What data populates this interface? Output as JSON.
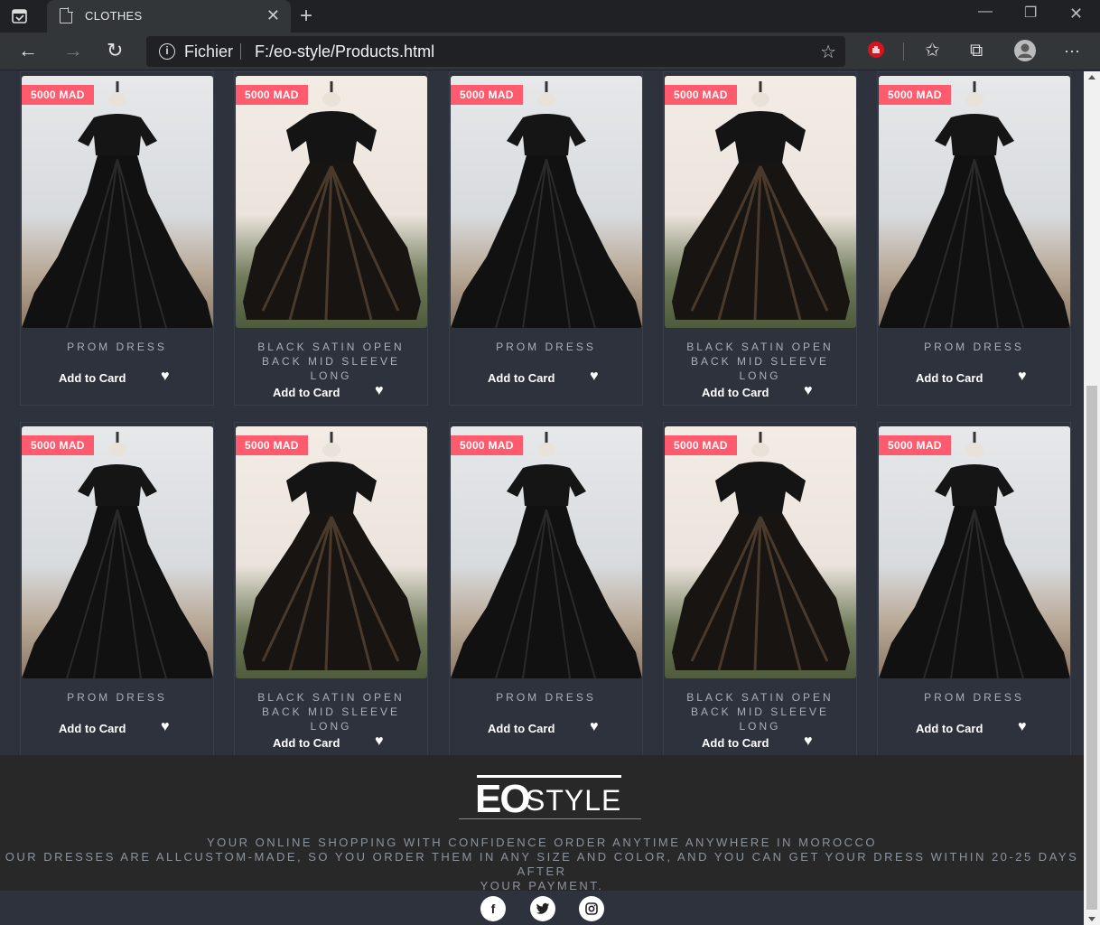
{
  "browser": {
    "tab_title": "CLOTHES",
    "address_protocol": "Fichier",
    "address_url": "F:/eo-style/Products.html"
  },
  "products": {
    "row1": [
      {
        "price": "5000 MAD",
        "name": "PROM DRESS",
        "add": "Add to Card",
        "style": "a"
      },
      {
        "price": "5000 MAD",
        "name": "BLACK SATIN OPEN BACK MID SLEEVE LONG",
        "add": "Add to Card",
        "style": "b"
      },
      {
        "price": "5000 MAD",
        "name": "PROM DRESS",
        "add": "Add to Card",
        "style": "a"
      },
      {
        "price": "5000 MAD",
        "name": "BLACK SATIN OPEN BACK MID SLEEVE LONG",
        "add": "Add to Card",
        "style": "b"
      },
      {
        "price": "5000 MAD",
        "name": "PROM DRESS",
        "add": "Add to Card",
        "style": "a"
      }
    ],
    "row2": [
      {
        "price": "5000 MAD",
        "name": "PROM DRESS",
        "add": "Add to Card",
        "style": "a"
      },
      {
        "price": "5000 MAD",
        "name": "BLACK SATIN OPEN BACK MID SLEEVE LONG",
        "add": "Add to Card",
        "style": "b"
      },
      {
        "price": "5000 MAD",
        "name": "PROM DRESS",
        "add": "Add to Card",
        "style": "a"
      },
      {
        "price": "5000 MAD",
        "name": "BLACK SATIN OPEN BACK MID SLEEVE LONG",
        "add": "Add to Card",
        "style": "b"
      },
      {
        "price": "5000 MAD",
        "name": "PROM DRESS",
        "add": "Add to Card",
        "style": "a"
      }
    ]
  },
  "footer": {
    "logo_eo": "EO",
    "logo_style": "STYLE",
    "tagline_1": "YOUR ONLINE SHOPPING WITH CONFIDENCE ORDER ANYTIME ANYWHERE IN MOROCCO",
    "tagline_2": "OUR DRESSES ARE ALLCUSTOM-MADE, SO YOU ORDER THEM IN ANY SIZE AND COLOR, AND YOU CAN GET YOUR DRESS WITHIN 20-25 DAYS AFTER",
    "tagline_3": "YOUR PAYMENT."
  },
  "social": [
    "facebook-icon",
    "twitter-icon",
    "instagram-icon"
  ]
}
